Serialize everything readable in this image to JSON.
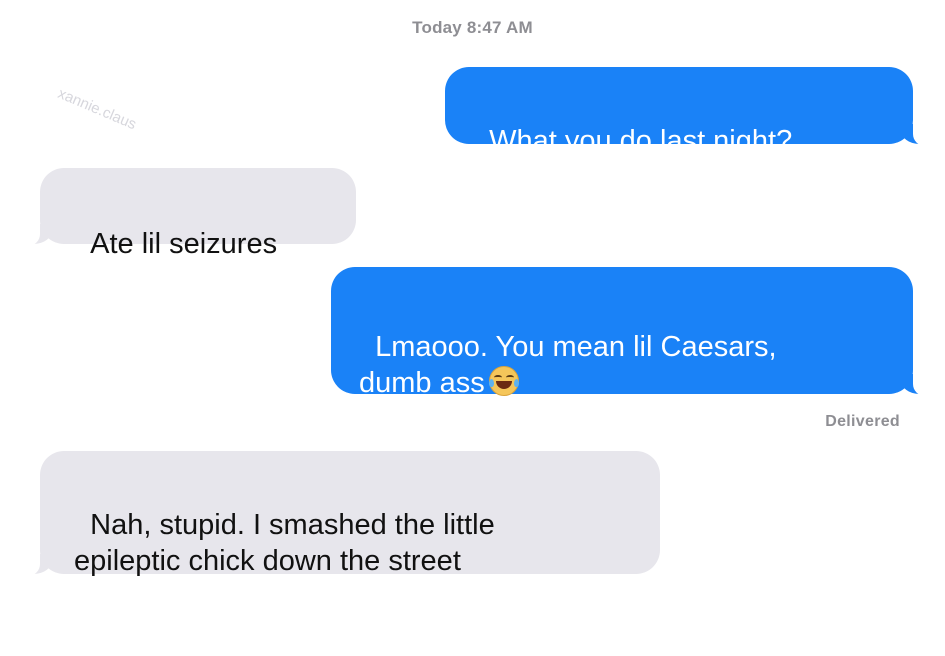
{
  "thread": {
    "timestamp": "Today 8:47 AM",
    "watermark": "xannie.claus",
    "messages": [
      {
        "sender": "me",
        "text": "What you do last night?"
      },
      {
        "sender": "them",
        "text": "Ate lil seizures"
      },
      {
        "sender": "me",
        "text": "Lmaooo. You mean lil Caesars,\ndumb ass",
        "emoji": "face-with-tears-of-joy-icon"
      },
      {
        "sender": "them",
        "text": "Nah, stupid. I smashed the little\nepileptic chick down the street"
      }
    ],
    "status": "Delivered"
  },
  "colors": {
    "sent_bubble": "#1a82f7",
    "received_bubble": "#e7e6ec",
    "meta_text": "#8e8e93"
  }
}
